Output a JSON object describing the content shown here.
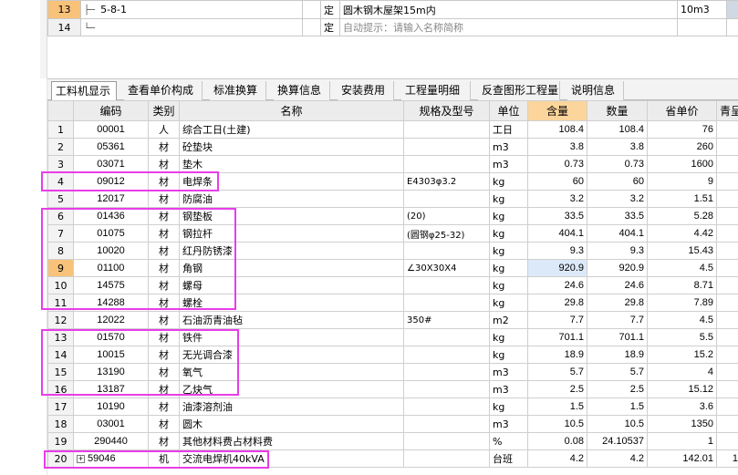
{
  "top_rows": [
    {
      "no": "13",
      "code": "5-8-1",
      "type": "定",
      "name": "圆木钢木屋架15m内",
      "unit": "10m3"
    },
    {
      "no": "14",
      "code": "",
      "type": "定",
      "name": "自动提示：请输入名称简称",
      "unit": ""
    }
  ],
  "tabs": [
    "工料机显示",
    "查看单价构成",
    "标准换算",
    "换算信息",
    "安装费用",
    "工程量明细",
    "反查图形工程量",
    "说明信息"
  ],
  "columns": [
    "编码",
    "类别",
    "名称",
    "规格及型号",
    "单位",
    "含量",
    "数量",
    "省单价",
    "青呈"
  ],
  "rows": [
    {
      "idx": "1",
      "code": "00001",
      "cat": "人",
      "name": "综合工日(土建)",
      "spec": "",
      "unit": "工日",
      "qty": "108.4",
      "amount": "108.4",
      "price": "76"
    },
    {
      "idx": "2",
      "code": "05361",
      "cat": "材",
      "name": "砼垫块",
      "spec": "",
      "unit": "m3",
      "qty": "3.8",
      "amount": "3.8",
      "price": "260"
    },
    {
      "idx": "3",
      "code": "03071",
      "cat": "材",
      "name": "垫木",
      "spec": "",
      "unit": "m3",
      "qty": "0.73",
      "amount": "0.73",
      "price": "1600"
    },
    {
      "idx": "4",
      "code": "09012",
      "cat": "材",
      "name": "电焊条",
      "spec": "E4303φ3.2",
      "unit": "kg",
      "qty": "60",
      "amount": "60",
      "price": "9"
    },
    {
      "idx": "5",
      "code": "12017",
      "cat": "材",
      "name": "防腐油",
      "spec": "",
      "unit": "kg",
      "qty": "3.2",
      "amount": "3.2",
      "price": "1.51"
    },
    {
      "idx": "6",
      "code": "01436",
      "cat": "材",
      "name": "钢垫板",
      "spec": "(20)",
      "unit": "kg",
      "qty": "33.5",
      "amount": "33.5",
      "price": "5.28"
    },
    {
      "idx": "7",
      "code": "01075",
      "cat": "材",
      "name": "钢拉杆",
      "spec": "(圆钢φ25-32)",
      "unit": "kg",
      "qty": "404.1",
      "amount": "404.1",
      "price": "4.42"
    },
    {
      "idx": "8",
      "code": "10020",
      "cat": "材",
      "name": "红丹防锈漆",
      "spec": "",
      "unit": "kg",
      "qty": "9.3",
      "amount": "9.3",
      "price": "15.43"
    },
    {
      "idx": "9",
      "code": "01100",
      "cat": "材",
      "name": "角钢",
      "spec": "∠30X30X4",
      "unit": "kg",
      "qty": "920.9",
      "amount": "920.9",
      "price": "4.5"
    },
    {
      "idx": "10",
      "code": "14575",
      "cat": "材",
      "name": "螺母",
      "spec": "",
      "unit": "kg",
      "qty": "24.6",
      "amount": "24.6",
      "price": "8.71"
    },
    {
      "idx": "11",
      "code": "14288",
      "cat": "材",
      "name": "螺栓",
      "spec": "",
      "unit": "kg",
      "qty": "29.8",
      "amount": "29.8",
      "price": "7.89"
    },
    {
      "idx": "12",
      "code": "12022",
      "cat": "材",
      "name": "石油沥青油毡",
      "spec": "350#",
      "unit": "m2",
      "qty": "7.7",
      "amount": "7.7",
      "price": "4.5"
    },
    {
      "idx": "13",
      "code": "01570",
      "cat": "材",
      "name": "铁件",
      "spec": "",
      "unit": "kg",
      "qty": "701.1",
      "amount": "701.1",
      "price": "5.5"
    },
    {
      "idx": "14",
      "code": "10015",
      "cat": "材",
      "name": "无光调合漆",
      "spec": "",
      "unit": "kg",
      "qty": "18.9",
      "amount": "18.9",
      "price": "15.2"
    },
    {
      "idx": "15",
      "code": "13190",
      "cat": "材",
      "name": "氧气",
      "spec": "",
      "unit": "m3",
      "qty": "5.7",
      "amount": "5.7",
      "price": "4"
    },
    {
      "idx": "16",
      "code": "13187",
      "cat": "材",
      "name": "乙炔气",
      "spec": "",
      "unit": "m3",
      "qty": "2.5",
      "amount": "2.5",
      "price": "15.12"
    },
    {
      "idx": "17",
      "code": "10190",
      "cat": "材",
      "name": "油漆溶剂油",
      "spec": "",
      "unit": "kg",
      "qty": "1.5",
      "amount": "1.5",
      "price": "3.6"
    },
    {
      "idx": "18",
      "code": "03001",
      "cat": "材",
      "name": "圆木",
      "spec": "",
      "unit": "m3",
      "qty": "10.5",
      "amount": "10.5",
      "price": "1350"
    },
    {
      "idx": "19",
      "code": "290440",
      "cat": "材",
      "name": "其他材料费占材料费",
      "spec": "",
      "unit": "%",
      "qty": "0.08",
      "amount": "24.10537",
      "price": "1"
    },
    {
      "idx": "20",
      "code": "59046",
      "cat": "机",
      "name": "交流电焊机40kVA",
      "spec": "",
      "unit": "台班",
      "qty": "4.2",
      "amount": "4.2",
      "price": "142.01"
    }
  ],
  "tail_values": [
    "1"
  ],
  "colors": {
    "highlight_box": "#e83de8",
    "header_highlight": "#fbd59b",
    "active_row_header": "#f8c27a"
  }
}
